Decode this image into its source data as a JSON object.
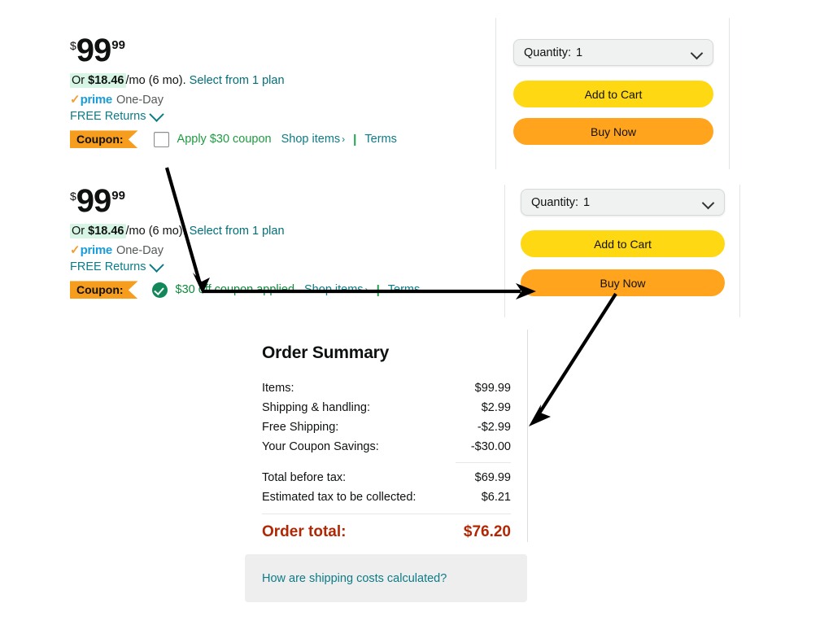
{
  "offers": [
    {
      "price": {
        "currency": "$",
        "whole": "99",
        "fraction": "99"
      },
      "installment": {
        "prefix": "Or",
        "amount": "$18.46",
        "suffix": "/mo (6 mo).",
        "link": "Select from 1 plan"
      },
      "prime": {
        "check": "✓",
        "brand": "prime",
        "shipping": "One-Day"
      },
      "returns": {
        "label": "FREE Returns",
        "icon": "chevron-down-icon"
      },
      "coupon": {
        "badge": "Coupon:",
        "state": "unchecked",
        "control": "checkbox",
        "text": "Apply $30 coupon",
        "shop_items": "Shop items",
        "shop_items_caret": "›",
        "separator": "|",
        "terms": "Terms"
      }
    },
    {
      "price": {
        "currency": "$",
        "whole": "99",
        "fraction": "99"
      },
      "installment": {
        "prefix": "Or",
        "amount": "$18.46",
        "suffix": "/mo (6 mo).",
        "link": "Select from 1 plan"
      },
      "prime": {
        "check": "✓",
        "brand": "prime",
        "shipping": "One-Day"
      },
      "returns": {
        "label": "FREE Returns",
        "icon": "chevron-down-icon"
      },
      "coupon": {
        "badge": "Coupon:",
        "state": "applied",
        "control": "check-circle-icon",
        "text": "$30 off coupon applied",
        "shop_items": "Shop items",
        "shop_items_caret": "›",
        "separator": "|",
        "terms": "Terms"
      }
    }
  ],
  "buyboxes": [
    {
      "quantity_label": "Quantity:",
      "quantity_value": "1",
      "caret_icon": "chevron-down-icon",
      "add_to_cart": "Add to Cart",
      "buy_now": "Buy Now"
    },
    {
      "quantity_label": "Quantity:",
      "quantity_value": "1",
      "caret_icon": "chevron-down-icon",
      "add_to_cart": "Add to Cart",
      "buy_now": "Buy Now"
    }
  ],
  "order_summary": {
    "title": "Order Summary",
    "rows": [
      {
        "label": "Items:",
        "value": "$99.99"
      },
      {
        "label": "Shipping & handling:",
        "value": "$2.99"
      },
      {
        "label": "Free Shipping:",
        "value": "-$2.99"
      },
      {
        "label": "Your Coupon Savings:",
        "value": "-$30.00"
      }
    ],
    "subtotal_rows": [
      {
        "label": "Total before tax:",
        "value": "$69.99"
      },
      {
        "label": "Estimated tax to be collected:",
        "value": "$6.21"
      }
    ],
    "total": {
      "label": "Order total:",
      "value": "$76.20"
    },
    "footer_link": "How are shipping costs calculated?"
  },
  "colors": {
    "coupon_badge": "#f79d1e",
    "add_to_cart": "#ffd814",
    "buy_now": "#ffa41c",
    "order_total": "#b12704",
    "link_teal": "#0b7c87",
    "coupon_green": "#1d9c3f",
    "applied_green": "#0f8a3c",
    "check_circle": "#11875a",
    "prime_blue": "#1b9cd8",
    "installment_highlight": "#d7f5e4"
  },
  "annotations": [
    {
      "name": "checkbox-to-buy-now-arrow",
      "from": "coupon-checkbox",
      "to": "buy-now-button-2"
    },
    {
      "name": "buy-now-to-order-summary-arrow",
      "from": "buy-now-button-2",
      "to": "order-summary"
    }
  ]
}
